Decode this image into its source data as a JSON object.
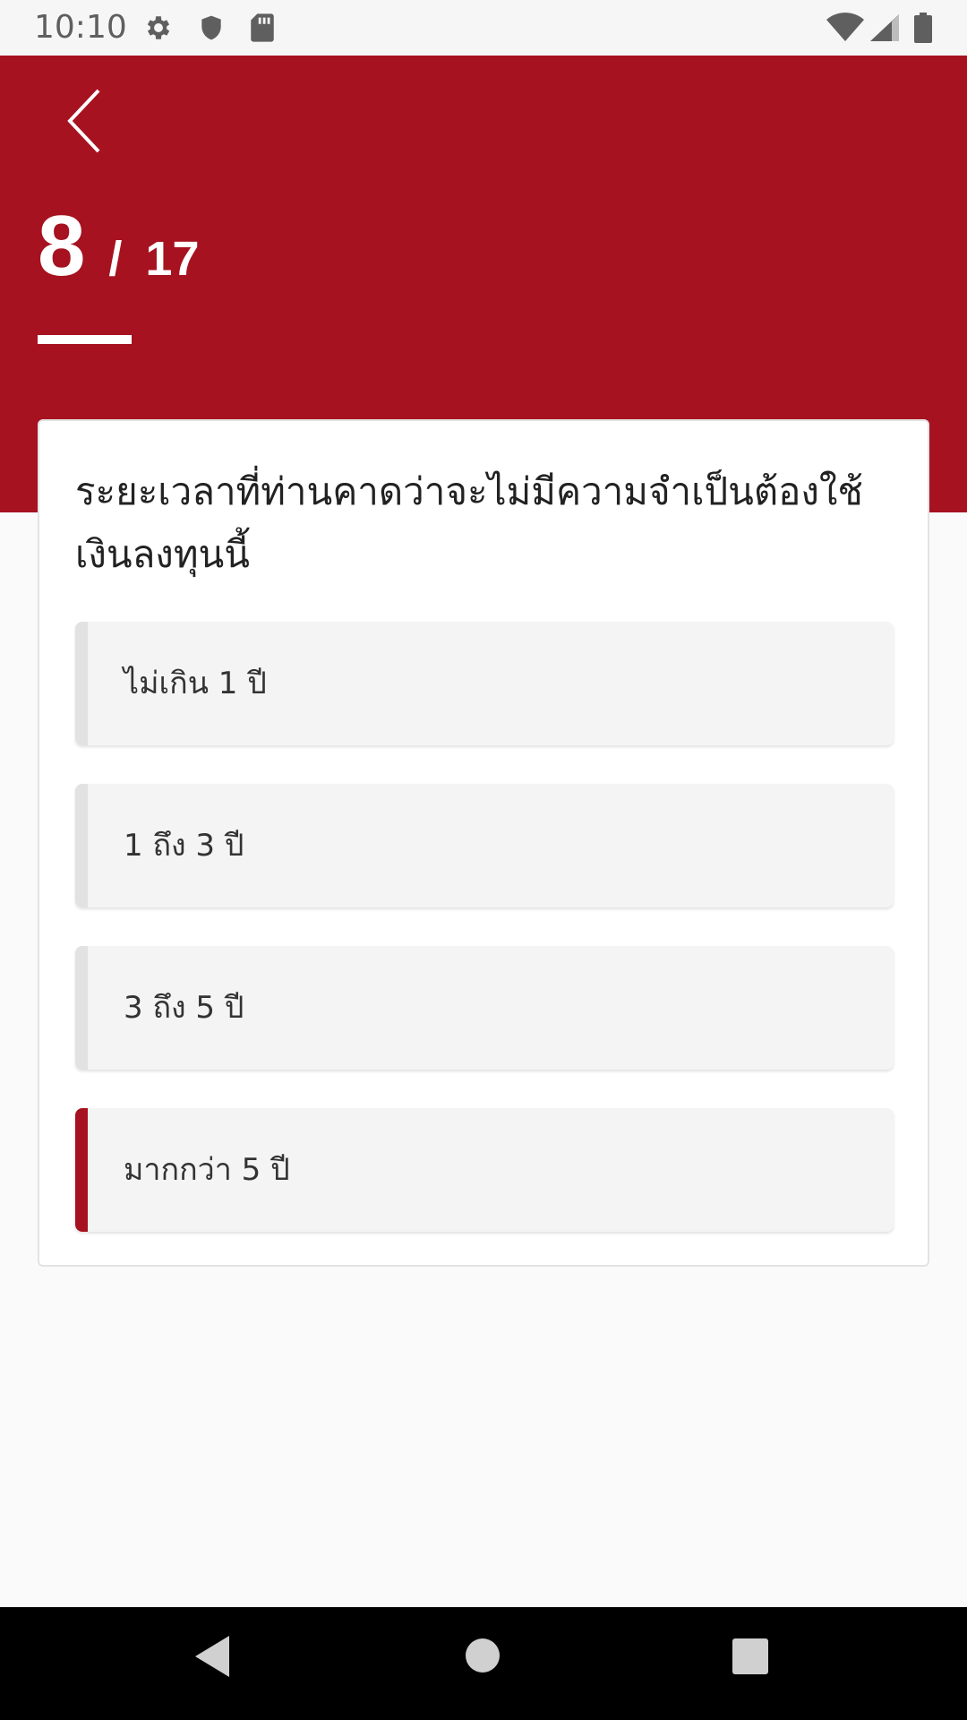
{
  "status_bar": {
    "time": "10:10",
    "left_icons": [
      "gear-icon",
      "shield-icon",
      "sd-card-icon"
    ],
    "right_icons": [
      "wifi-icon",
      "signal-icon",
      "battery-icon"
    ]
  },
  "header": {
    "back_icon": "chevron-left-icon",
    "current_question": "8",
    "separator": "/",
    "total_questions": "17",
    "accent_color": "#a6121f"
  },
  "question": {
    "text": "ระยะเวลาที่ท่านคาดว่าจะไม่มีความจำเป็นต้องใช้เงินลงทุนนี้",
    "options": [
      {
        "label": "ไม่เกิน 1 ปี",
        "selected": false
      },
      {
        "label": "1 ถึง 3 ปี",
        "selected": false
      },
      {
        "label": "3 ถึง 5 ปี",
        "selected": false
      },
      {
        "label": "มากกว่า 5 ปี",
        "selected": true
      }
    ]
  },
  "nav_bar": {
    "icons": [
      "back-triangle-icon",
      "home-circle-icon",
      "recents-square-icon"
    ]
  }
}
